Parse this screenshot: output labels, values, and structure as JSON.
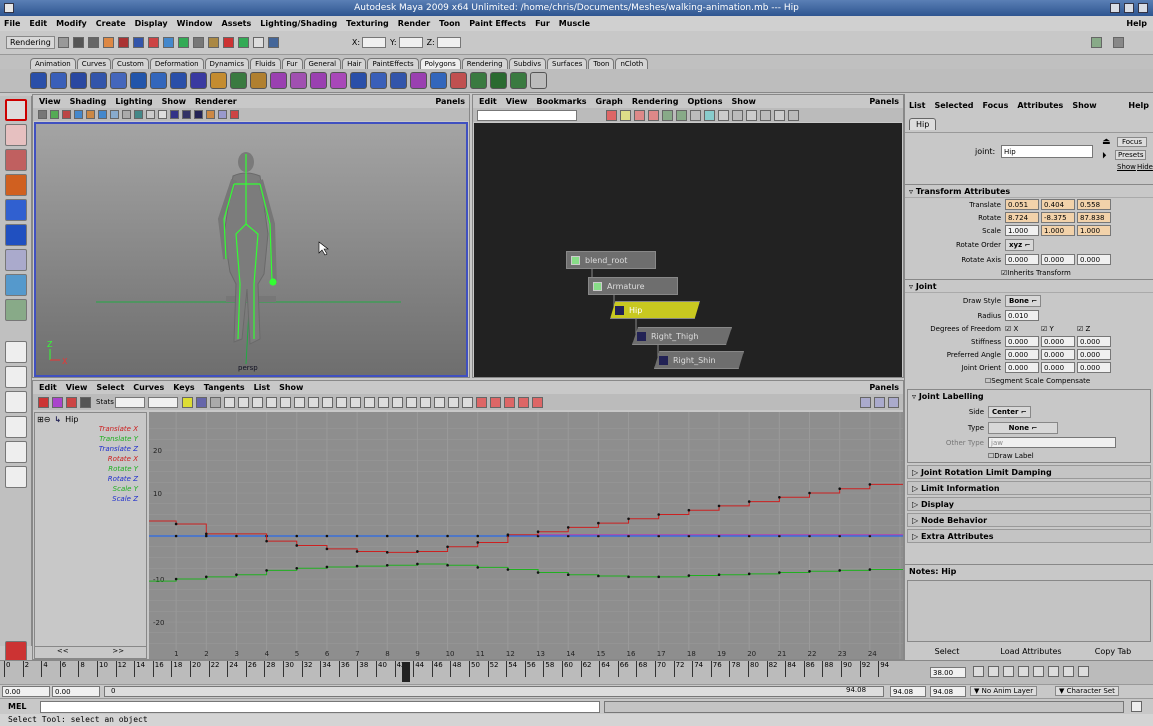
{
  "window": {
    "title": "Autodesk Maya 2009 x64 Unlimited: /home/chris/Documents/Meshes/walking-animation.mb  ---  Hip"
  },
  "main_menu": [
    "File",
    "Edit",
    "Modify",
    "Create",
    "Display",
    "Window",
    "Assets",
    "Lighting/Shading",
    "Texturing",
    "Render",
    "Toon",
    "Paint Effects",
    "Fur",
    "Muscle"
  ],
  "main_menu_right": "Help",
  "status_line": {
    "menu_set": "Rendering",
    "x_label": "X:",
    "y_label": "Y:",
    "z_label": "Z:"
  },
  "shelf_tabs": [
    "Animation",
    "Curves",
    "Custom",
    "Deformation",
    "Dynamics",
    "Fluids",
    "Fur",
    "General",
    "Hair",
    "PaintEffects",
    "Polygons",
    "Rendering",
    "Subdivs",
    "Surfaces",
    "Toon",
    "nCloth"
  ],
  "active_shelf_tab": "Polygons",
  "viewport": {
    "menu": [
      "View",
      "Shading",
      "Lighting",
      "Show",
      "Renderer"
    ],
    "panels": "Panels",
    "camera_label": "persp",
    "axis_x": "X",
    "axis_z": "Z"
  },
  "hypergraph": {
    "menu": [
      "Edit",
      "View",
      "Bookmarks",
      "Graph",
      "Rendering",
      "Options",
      "Show"
    ],
    "panels": "Panels",
    "nodes": [
      {
        "label": "blend_root"
      },
      {
        "label": "Armature"
      },
      {
        "label": "Hip"
      },
      {
        "label": "Right_Thigh"
      },
      {
        "label": "Right_Shin"
      }
    ]
  },
  "graph_editor": {
    "menu": [
      "Edit",
      "View",
      "Select",
      "Curves",
      "Keys",
      "Tangents",
      "List",
      "Show"
    ],
    "panels": "Panels",
    "stats_label": "Stats",
    "outliner_node": "Hip",
    "channels": [
      {
        "name": "Translate X",
        "color": "#cc2020"
      },
      {
        "name": "Translate Y",
        "color": "#20b020"
      },
      {
        "name": "Translate Z",
        "color": "#2030cc"
      },
      {
        "name": "Rotate X",
        "color": "#cc2020"
      },
      {
        "name": "Rotate Y",
        "color": "#20b020"
      },
      {
        "name": "Rotate Z",
        "color": "#2030cc"
      },
      {
        "name": "Scale Y",
        "color": "#20b020"
      },
      {
        "name": "Scale Z",
        "color": "#2030cc"
      }
    ],
    "scroll_left": "<<",
    "scroll_right": ">>",
    "y_ticks": [
      "20",
      "10",
      "-10",
      "-20"
    ],
    "x_ticks": [
      "1",
      "2",
      "3",
      "4",
      "5",
      "6",
      "7",
      "8",
      "9",
      "10",
      "11",
      "12",
      "13",
      "14",
      "15",
      "16",
      "17",
      "18",
      "19",
      "20",
      "21",
      "22",
      "23",
      "24"
    ]
  },
  "attribute_editor": {
    "menu": [
      "List",
      "Selected",
      "Focus",
      "Attributes",
      "Show"
    ],
    "help": "Help",
    "tab": "Hip",
    "joint_label": "joint:",
    "joint_name": "Hip",
    "focus": "Focus",
    "presets": "Presets",
    "show": "Show",
    "hide": "Hide",
    "transform_title": "Transform Attributes",
    "translate_label": "Translate",
    "translate": [
      "0.051",
      "0.404",
      "0.558"
    ],
    "rotate_label": "Rotate",
    "rotate": [
      "8.724",
      "-8.375",
      "87.838"
    ],
    "scale_label": "Scale",
    "scale": [
      "1.000",
      "1.000",
      "1.000"
    ],
    "rotate_order_label": "Rotate Order",
    "rotate_order": "xyz",
    "rotate_axis_label": "Rotate Axis",
    "rotate_axis": [
      "0.000",
      "0.000",
      "0.000"
    ],
    "inherits_transform": "Inherits Transform",
    "joint_title": "Joint",
    "draw_style_label": "Draw Style",
    "draw_style": "Bone",
    "radius_label": "Radius",
    "radius": "0.010",
    "dof_label": "Degrees of Freedom",
    "dof": [
      "X",
      "Y",
      "Z"
    ],
    "stiffness_label": "Stiffness",
    "stiffness": [
      "0.000",
      "0.000",
      "0.000"
    ],
    "preferred_label": "Preferred Angle",
    "preferred": [
      "0.000",
      "0.000",
      "0.000"
    ],
    "orient_label": "Joint Orient",
    "orient": [
      "0.000",
      "0.000",
      "0.000"
    ],
    "segment_scale": "Segment Scale Compensate",
    "labelling_title": "Joint Labelling",
    "side_label": "Side",
    "side": "Center",
    "type_label": "Type",
    "type": "None",
    "other_type_label": "Other Type",
    "other_type": "jaw",
    "draw_label": "Draw Label",
    "closed_sections": [
      "Joint Rotation Limit Damping",
      "Limit Information",
      "Display",
      "Node Behavior",
      "Extra Attributes"
    ],
    "notes_label": "Notes: Hip",
    "buttons": [
      "Select",
      "Load Attributes",
      "Copy Tab"
    ]
  },
  "time_slider": {
    "ticks": [
      "0",
      "2",
      "4",
      "6",
      "8",
      "10",
      "12",
      "14",
      "16",
      "18",
      "20",
      "22",
      "24",
      "26",
      "28",
      "30",
      "32",
      "34",
      "36",
      "38",
      "40",
      "42",
      "44",
      "46",
      "48",
      "50",
      "52",
      "54",
      "56",
      "58",
      "60",
      "62",
      "64",
      "66",
      "68",
      "70",
      "72",
      "74",
      "76",
      "78",
      "80",
      "82",
      "84",
      "86",
      "88",
      "90",
      "92",
      "94"
    ],
    "current_time": "38.00"
  },
  "range_slider": {
    "start": "0.00",
    "start2": "0.00",
    "inner_start": "0",
    "end": "94.08",
    "end2": "94.08",
    "end3": "94.08",
    "anim_layer": "No Anim Layer",
    "character_set": "Character Set"
  },
  "mel": {
    "label": "MEL"
  },
  "help_line": "Select Tool: select an object"
}
